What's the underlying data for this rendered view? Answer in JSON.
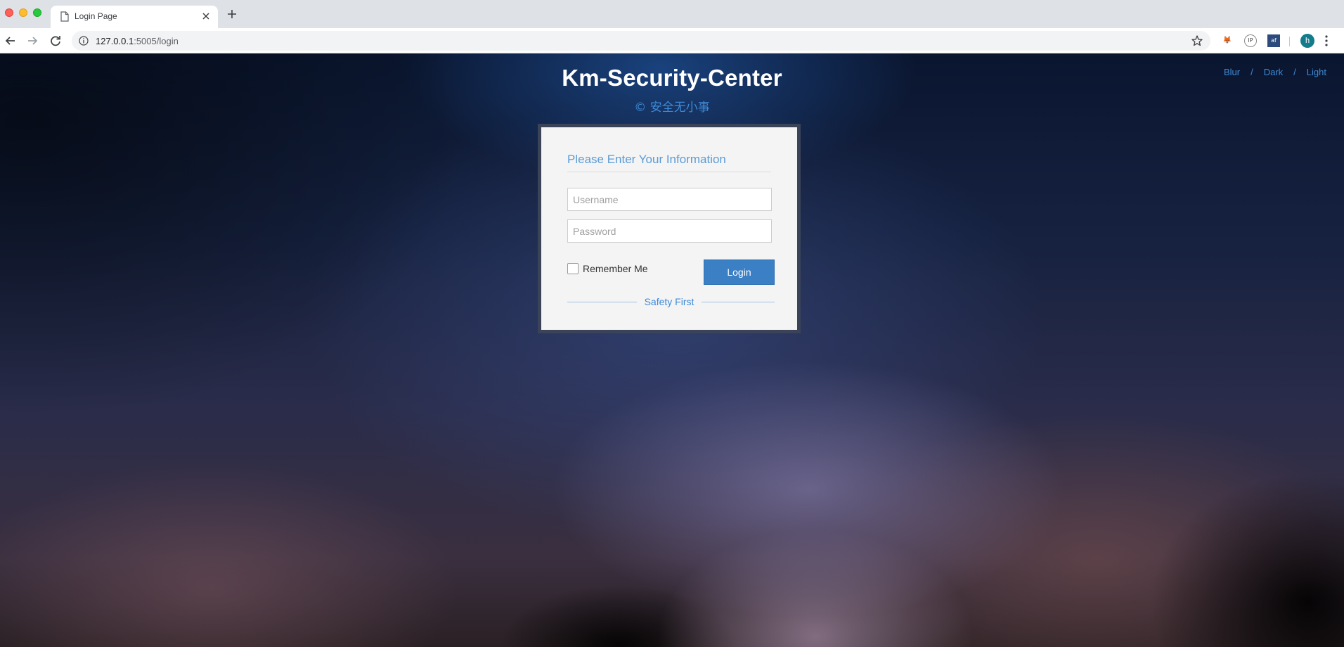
{
  "browser": {
    "tab_title": "Login Page",
    "url_host": "127.0.0.1",
    "url_rest": ":5005/login",
    "profile_initial": "h",
    "extensions": [
      "metamask-icon",
      "ip-icon",
      "tool-icon"
    ]
  },
  "header": {
    "title": "Km-Security-Center",
    "subtitle": "© 安全无小事"
  },
  "themes": {
    "blur": "Blur",
    "dark": "Dark",
    "light": "Light",
    "separator": "/"
  },
  "login_form": {
    "heading": "Please Enter Your Information",
    "username_placeholder": "Username",
    "password_placeholder": "Password",
    "remember_label": "Remember Me",
    "remember_checked": false,
    "login_label": "Login",
    "footer_text": "Safety First"
  },
  "colors": {
    "accent": "#3e8ad6",
    "button": "#3b7fc4",
    "form_bg": "#f4f4f4",
    "frame": "#3a4357"
  }
}
